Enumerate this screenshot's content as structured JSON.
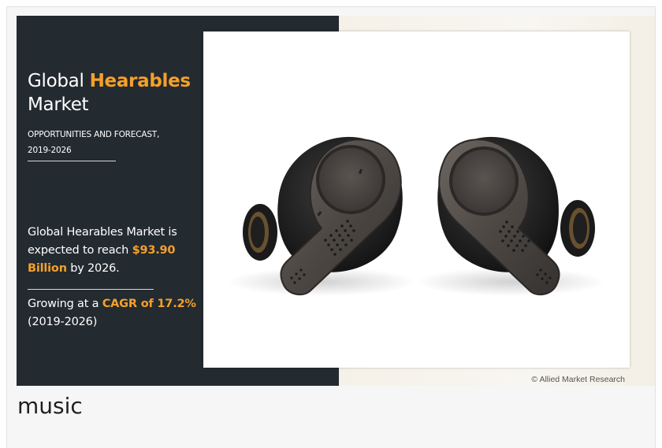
{
  "infographic": {
    "title_prefix": "Global ",
    "title_highlight": "Hearables",
    "title_suffix": "Market",
    "subtitle_line1": "OPPORTUNITIES AND FORECAST,",
    "subtitle_line2": "2019-2026",
    "stat1_text_a": "Global Hearables Market is expected to reach ",
    "stat1_highlight": "$93.90 Billion",
    "stat1_text_b": " by 2026.",
    "stat2_text_a": "Growing at a ",
    "stat2_highlight": "CAGR of 17.2%",
    "stat2_text_b": "(2019-2026)",
    "credit": "© Allied Market Research",
    "accent_color": "#f5a02a",
    "panel_color": "#232a30"
  },
  "caption": "music"
}
